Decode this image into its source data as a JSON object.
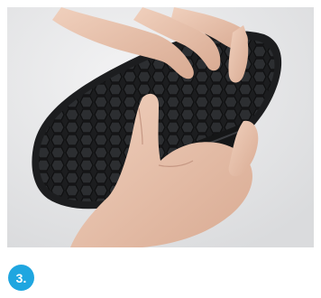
{
  "step": {
    "number_label": "3.",
    "badge_color": "#1fa6e0"
  },
  "photo": {
    "background_color": "#e9eaec",
    "sole_color": "#1c1d1f",
    "skin_color": "#e8c3ae"
  }
}
